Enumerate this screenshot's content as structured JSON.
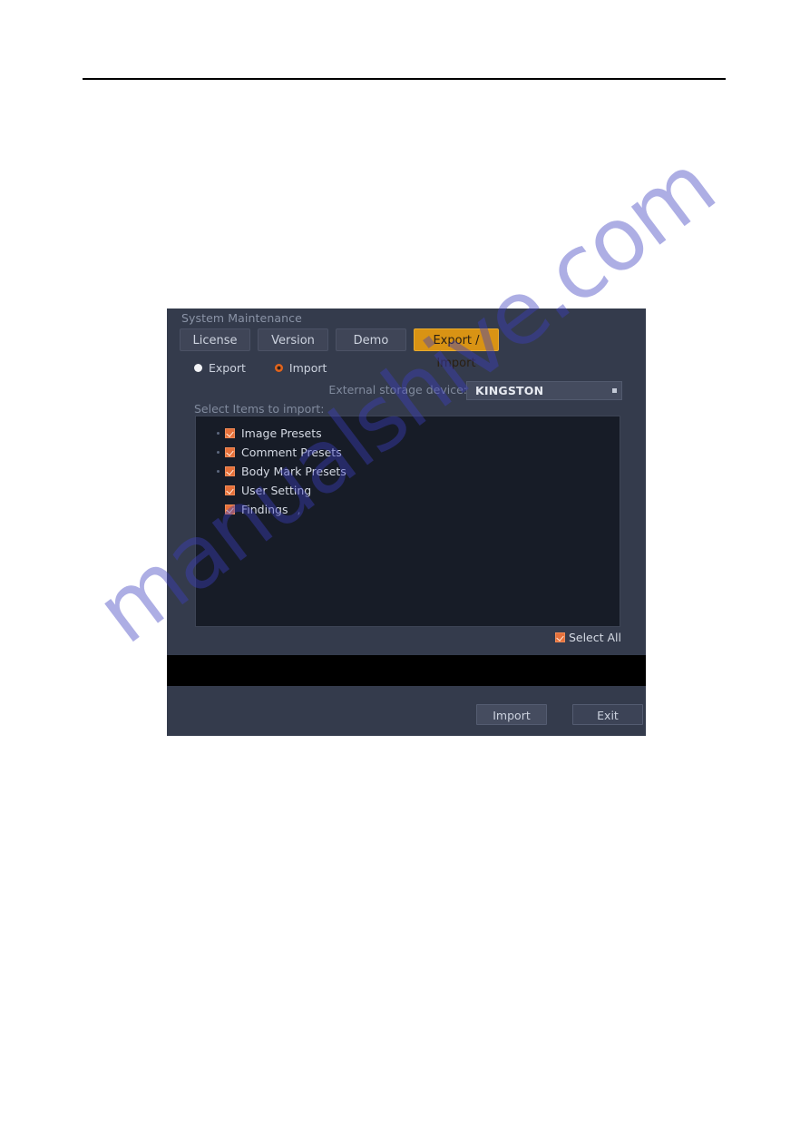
{
  "dialog": {
    "title": "System Maintenance",
    "tabs": [
      {
        "label": "License",
        "active": false
      },
      {
        "label": "Version",
        "active": false
      },
      {
        "label": "Demo",
        "active": false
      },
      {
        "label": "Export / Import",
        "active": true
      }
    ],
    "mode_options": [
      {
        "label": "Export",
        "selected": false
      },
      {
        "label": "Import",
        "selected": true
      }
    ],
    "storage": {
      "label": "External storage device:",
      "selected_value": "KINGSTON",
      "options": [
        "KINGSTON"
      ]
    },
    "list": {
      "label": "Select Items to import:",
      "items": [
        {
          "label": "Image Presets",
          "checked": true,
          "expandable": true,
          "suffix": ""
        },
        {
          "label": "Comment Presets",
          "checked": true,
          "expandable": true,
          "suffix": ""
        },
        {
          "label": "Body Mark Presets",
          "checked": true,
          "expandable": true,
          "suffix": ""
        },
        {
          "label": "User Setting",
          "checked": true,
          "expandable": false,
          "suffix": ""
        },
        {
          "label": "Findings",
          "checked": true,
          "expandable": false,
          "suffix": ","
        }
      ]
    },
    "select_all": {
      "label": "Select All",
      "checked": true
    },
    "buttons": [
      {
        "label": "Import"
      },
      {
        "label": "Exit"
      }
    ]
  },
  "watermark": {
    "text": "manualshive.com"
  },
  "colors": {
    "dialog_bg": "#343b4c",
    "tab_bg": "#3f4557",
    "tab_active_bg": "#d99314",
    "list_bg": "#171c27",
    "checkbox": "#e6703a",
    "radio_selected": "#e0651f",
    "text": "#ccd2de",
    "muted_text": "#808a9d",
    "strip": "#000000"
  }
}
